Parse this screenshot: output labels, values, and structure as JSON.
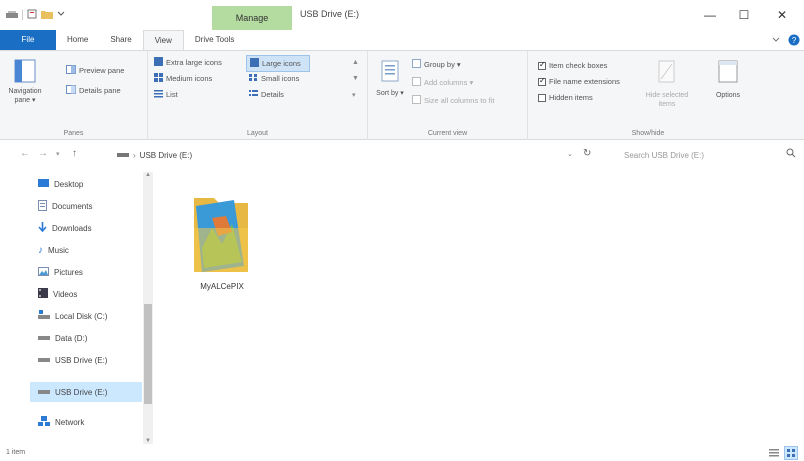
{
  "window": {
    "manage_label": "Manage",
    "title": "USB Drive (E:)",
    "minimize": "—",
    "maximize": "☐",
    "close": "✕"
  },
  "tabs": [
    {
      "label": "File"
    },
    {
      "label": "Home"
    },
    {
      "label": "Share"
    },
    {
      "label": "View"
    },
    {
      "label": "Drive Tools"
    }
  ],
  "ribbon": {
    "panes": {
      "group_label": "Panes",
      "navigation_pane": "Navigation pane ▾",
      "preview_pane": "Preview pane",
      "details_pane": "Details pane"
    },
    "layout": {
      "group_label": "Layout",
      "items": [
        "Extra large icons",
        "Large icons",
        "Medium icons",
        "Small icons",
        "List",
        "Details"
      ]
    },
    "current_view": {
      "group_label": "Current view",
      "sort_by": "Sort by ▾",
      "group_by": "Group by ▾",
      "add_columns": "Add columns ▾",
      "size_all": "Size all columns to fit"
    },
    "show_hide": {
      "group_label": "Show/hide",
      "item_check_boxes": "Item check boxes",
      "file_name_extensions": "File name extensions",
      "hidden_items": "Hidden items",
      "hide_selected": "Hide selected items",
      "options": "Options"
    }
  },
  "address": {
    "path_label": "USB Drive (E:)",
    "search_placeholder": "Search USB Drive (E:)"
  },
  "sidebar": {
    "items": [
      {
        "label": "Desktop"
      },
      {
        "label": "Documents"
      },
      {
        "label": "Downloads"
      },
      {
        "label": "Music"
      },
      {
        "label": "Pictures"
      },
      {
        "label": "Videos"
      },
      {
        "label": "Local Disk (C:)"
      },
      {
        "label": "Data (D:)"
      },
      {
        "label": "USB Drive (E:)"
      },
      {
        "label": "USB Drive (E:)"
      },
      {
        "label": "Network"
      }
    ]
  },
  "files": [
    {
      "name": "MyALCePIX"
    }
  ],
  "status": {
    "count": "1 item"
  },
  "colors": {
    "accent": "#1a6fc4",
    "manage": "#b4dba0",
    "selection": "#cce8ff"
  }
}
